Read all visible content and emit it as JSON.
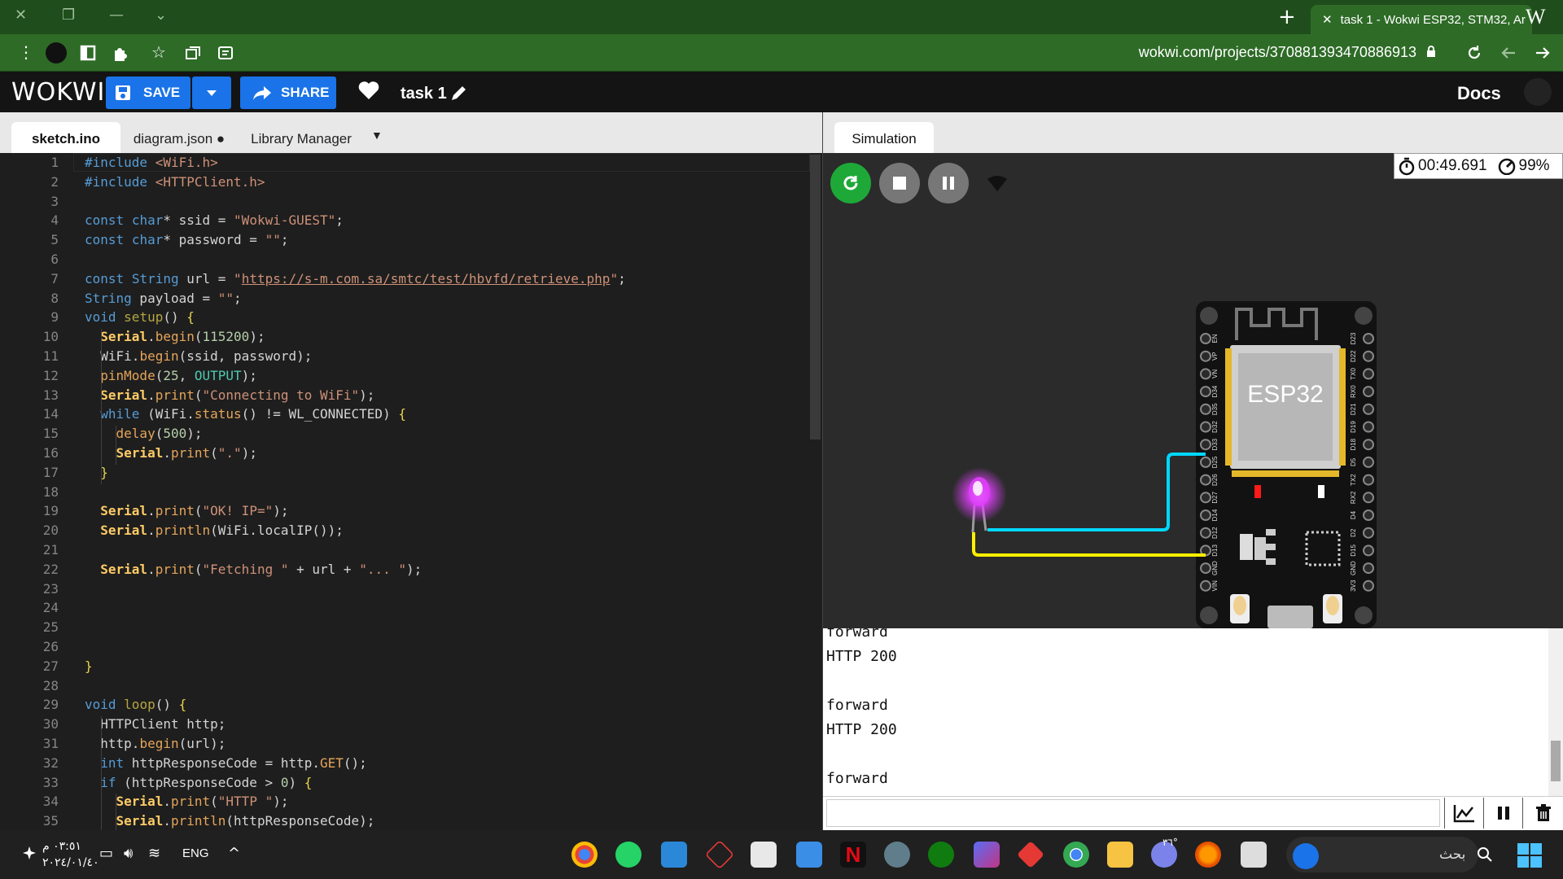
{
  "browser": {
    "tab_title": "task 1 - Wokwi ESP32, STM32, Ar",
    "url": "wokwi.com/projects/370881393470886913",
    "close": "✕",
    "newtab": "+",
    "tab_w": "W",
    "min": "—",
    "chev": "⌄",
    "max": "❐",
    "xwin": "✕"
  },
  "header": {
    "logo": "WOKWI",
    "save_label": "SAVE",
    "share_label": "SHARE",
    "project_name": "task 1",
    "docs_label": "Docs"
  },
  "editor": {
    "tabs": [
      "sketch.ino",
      "diagram.json ●",
      "Library Manager"
    ],
    "menu_glyph": "▼"
  },
  "code_lines": [
    "#include <WiFi.h>",
    "#include <HTTPClient.h>",
    "",
    "const char* ssid = \"Wokwi-GUEST\";",
    "const char* password = \"\";",
    "",
    "const String url = \"https://s-m.com.sa/smtc/test/hbvfd/retrieve.php\";",
    "String payload = \"\";",
    "void setup() {",
    "  Serial.begin(115200);",
    "  WiFi.begin(ssid, password);",
    "  pinMode(25, OUTPUT);",
    "  Serial.print(\"Connecting to WiFi\");",
    "  while (WiFi.status() != WL_CONNECTED) {",
    "    delay(500);",
    "    Serial.print(\".\");",
    "  }",
    "",
    "  Serial.print(\"OK! IP=\");",
    "  Serial.println(WiFi.localIP());",
    "",
    "  Serial.print(\"Fetching \" + url + \"... \");",
    "",
    "",
    "",
    "",
    "}",
    "",
    "void loop() {",
    "  HTTPClient http;",
    "  http.begin(url);",
    "  int httpResponseCode = http.GET();",
    "  if (httpResponseCode > 0) {",
    "    Serial.print(\"HTTP \");",
    "    Serial.println(httpResponseCode);"
  ],
  "simulation": {
    "tab_label": "Simulation",
    "timer": "00:49.691",
    "speed": "99%",
    "board_label": "ESP32",
    "pins_left": [
      "EN",
      "VP",
      "VN",
      "D34",
      "D35",
      "D32",
      "D33",
      "D25",
      "D26",
      "D27",
      "D14",
      "D12",
      "D13",
      "GND",
      "VIN"
    ],
    "pins_right": [
      "D23",
      "D22",
      "TX0",
      "RX0",
      "D21",
      "D19",
      "D18",
      "D5",
      "TX2",
      "RX2",
      "D4",
      "D2",
      "D15",
      "GND",
      "3V3"
    ],
    "led_color": "#e040fb",
    "wire_colors": [
      "#00d8ff",
      "#ffee00"
    ]
  },
  "serial_lines": [
    "forward",
    "HTTP 200",
    "",
    "forward",
    "HTTP 200",
    "",
    "forward"
  ],
  "taskbar": {
    "time": "٠٣:٥١ م",
    "date": "٢٠٢٤/٠١/٤٠",
    "lang": "ENG",
    "search": "بحث",
    "weather_temp": "٣٦°",
    "caret": "^"
  }
}
